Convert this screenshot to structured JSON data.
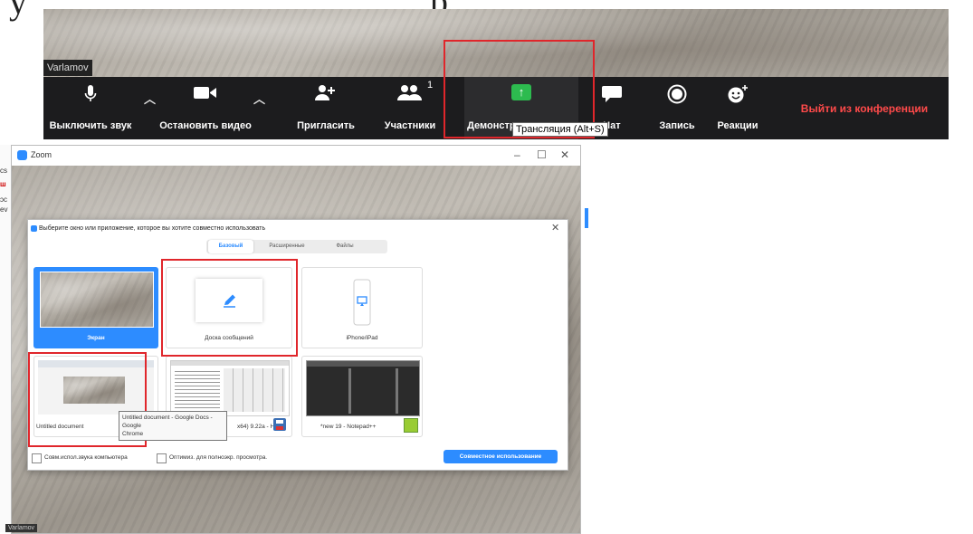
{
  "top_text": {
    "left": "у",
    "right": "р"
  },
  "top_window": {
    "participant_name": "Varlamov",
    "toolbar": {
      "mute": "Выключить звук",
      "stop_video": "Остановить видео",
      "invite": "Пригласить",
      "participants": "Участники",
      "participants_count": "1",
      "share_screen": "Демонстрация экрана",
      "chat": "Чат",
      "record": "Запись",
      "reactions": "Реакции",
      "leave": "Выйти из конференции"
    },
    "tooltip": "Трансляция (Alt+S)"
  },
  "zoom_window": {
    "title": "Zoom",
    "participant_name": "Varlamov",
    "side_text": [
      "cs",
      "ш",
      "ɔc",
      "ev"
    ],
    "dialog": {
      "title": "Выберите окно или приложение, которое вы хотите совместно использовать",
      "tabs": [
        "Базовый",
        "Расширенные",
        "Файлы"
      ],
      "active_tab": "Базовый",
      "tiles": [
        {
          "caption": "Экран",
          "selected": true
        },
        {
          "caption": "Доска сообщений",
          "selected": false
        },
        {
          "caption": "iPhone/iPad",
          "selected": false
        },
        {
          "caption": "Untitled document",
          "selected": false
        },
        {
          "caption": "x64) 9.22a - H...",
          "selected": false
        },
        {
          "caption": "*new 19 - Notepad++",
          "selected": false
        }
      ],
      "tooltip_line1": "Untitled document - Google Docs - Google",
      "tooltip_line2": "Chrome",
      "options": {
        "share_sound": "Совм.испол.звука компьютера",
        "optimize": "Оптимиз. для полноэкр. просмотра."
      },
      "share_button": "Совместное использование"
    }
  },
  "colors": {
    "accent": "#2d8cff",
    "highlight": "#e0262b",
    "leave": "#ff4a4a",
    "share_green": "#2dbb4f"
  }
}
